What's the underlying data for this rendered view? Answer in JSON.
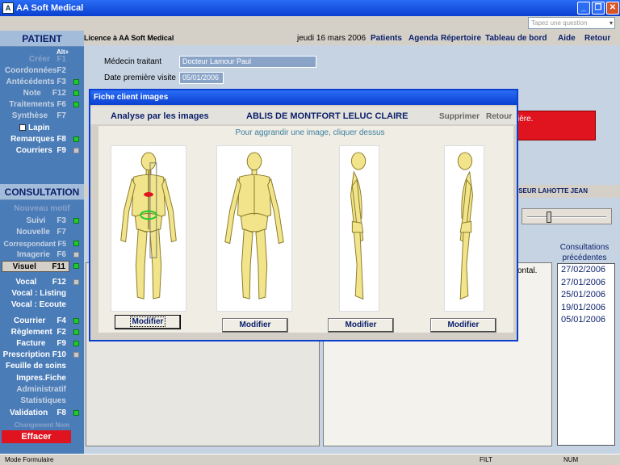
{
  "window": {
    "title": "AA Soft Medical"
  },
  "search": {
    "placeholder": "Tapez une question"
  },
  "sidebar": {
    "patient_header": "PATIENT",
    "alt_hint": "Alt+",
    "patient_items": [
      {
        "label": "Créer",
        "key": "F1"
      },
      {
        "label": "Coordonnées",
        "key": "F2"
      },
      {
        "label": "Antécédents",
        "key": "F3"
      },
      {
        "label": "Note",
        "key": "F12"
      },
      {
        "label": "Traitements",
        "key": "F6"
      },
      {
        "label": "Synthèse",
        "key": "F7"
      },
      {
        "label": "Lapin",
        "key": ""
      },
      {
        "label": "Remarques",
        "key": "F8"
      },
      {
        "label": "Courriers",
        "key": "F9"
      }
    ],
    "consultation_header": "CONSULTATION",
    "consultation_items": [
      {
        "label": "Nouveau motif",
        "key": ""
      },
      {
        "label": "Suivi",
        "key": "F3"
      },
      {
        "label": "Nouvelle",
        "key": "F7"
      },
      {
        "label": "Correspondant",
        "key": "F5"
      },
      {
        "label": "Imagerie",
        "key": "F6"
      },
      {
        "label": "Visuel",
        "key": "F11"
      },
      {
        "label": "Vocal",
        "key": "F12"
      },
      {
        "label": "Vocal : Listing",
        "key": ""
      },
      {
        "label": "Vocal : Ecoute",
        "key": ""
      },
      {
        "label": "Courrier",
        "key": "F4"
      },
      {
        "label": "Règlement",
        "key": "F2"
      },
      {
        "label": "Facture",
        "key": "F9"
      },
      {
        "label": "Prescription",
        "key": "F10"
      },
      {
        "label": "Feuille de soins",
        "key": ""
      },
      {
        "label": "Impres.Fiche",
        "key": ""
      },
      {
        "label": "Administratif",
        "key": ""
      },
      {
        "label": "Statistiques",
        "key": ""
      },
      {
        "label": "Validation",
        "key": "F8"
      },
      {
        "label": "Changement Nom",
        "key": ""
      },
      {
        "label": "Effacer",
        "key": ""
      }
    ]
  },
  "header": {
    "licence": "Licence à  AA Soft Medical",
    "date": "jeudi 16 mars 2006",
    "nav": [
      "Patients",
      "Agenda",
      "Répertoire",
      "Tableau de bord",
      "Aide",
      "Retour"
    ]
  },
  "patient_form": {
    "medecin_label": "Médecin traitant",
    "medecin_value": "Docteur Lamour Paul",
    "premiere_label": "Date première visite",
    "premiere_value": "05/01/2006",
    "red_note": "ière."
  },
  "consultation_bar": {
    "doctor": "SEUR LAHOTTE JEAN"
  },
  "notes": {
    "text": "ontal."
  },
  "previous": {
    "title": "Consultations précédentes",
    "dates": [
      "27/02/2006",
      "27/01/2006",
      "25/01/2006",
      "19/01/2006",
      "05/01/2006"
    ]
  },
  "dialog": {
    "title": "Fiche client images",
    "analyse": "Analyse par les images",
    "patient_name": "ABLIS DE MONTFORT LELUC CLAIRE",
    "supprimer": "Supprimer",
    "retour": "Retour",
    "hint": "Pour aggrandir une image, cliquer dessus",
    "images": [
      {
        "name": "posterior-annotated",
        "button": "Modifier"
      },
      {
        "name": "anterior",
        "button": "Modifier"
      },
      {
        "name": "lateral-left",
        "button": "Modifier"
      },
      {
        "name": "lateral-right",
        "button": "Modifier"
      }
    ]
  },
  "status": {
    "mode": "Mode Formulaire",
    "filt": "FILT",
    "num": "NUM"
  }
}
